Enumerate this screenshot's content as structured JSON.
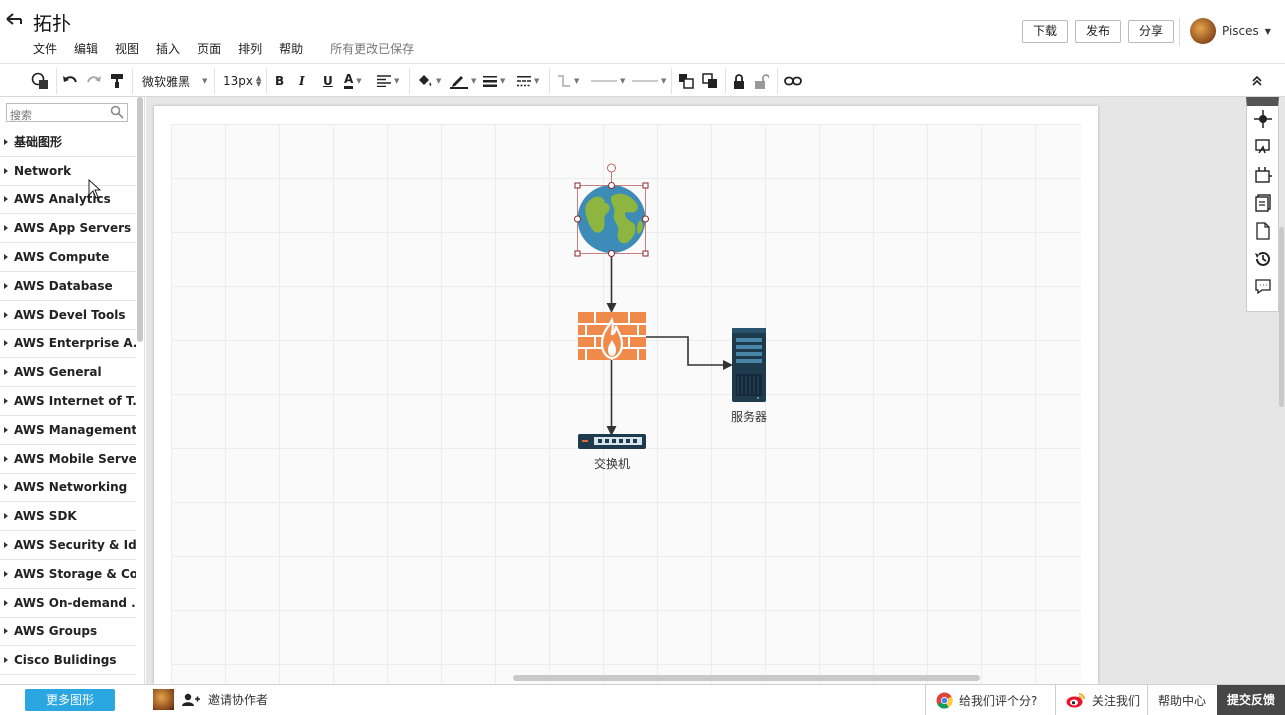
{
  "header": {
    "back_icon": "back-arrow-icon",
    "title": "拓扑",
    "menu": [
      "文件",
      "编辑",
      "视图",
      "插入",
      "页面",
      "排列",
      "帮助"
    ],
    "save_status": "所有更改已保存",
    "buttons": {
      "download": "下载",
      "publish": "发布",
      "share": "分享"
    },
    "user_name": "Pisces"
  },
  "toolbar": {
    "font_family": "微软雅黑",
    "font_size": "13px",
    "bold": "B",
    "italic": "I",
    "underline": "U",
    "font_color": "A"
  },
  "sidebar": {
    "search_placeholder": "搜索",
    "categories": [
      "基础图形",
      "Network",
      "AWS Analytics",
      "AWS App Servers",
      "AWS Compute",
      "AWS Database",
      "AWS Devel Tools",
      "AWS Enterprise A...",
      "AWS General",
      "AWS Internet of T...",
      "AWS Management...",
      "AWS Mobile Servers",
      "AWS Networking",
      "AWS SDK",
      "AWS Security & Id...",
      "AWS Storage & Co...",
      "AWS On-demand ...",
      "AWS Groups",
      "Cisco Bulidings"
    ]
  },
  "diagram": {
    "nodes": {
      "server_label": "服务器",
      "switch_label": "交换机"
    }
  },
  "bottom": {
    "more_shapes": "更多图形",
    "invite": "邀请协作者",
    "rate": "给我们评个分?",
    "follow": "关注我们",
    "help": "帮助中心",
    "feedback": "提交反馈"
  }
}
